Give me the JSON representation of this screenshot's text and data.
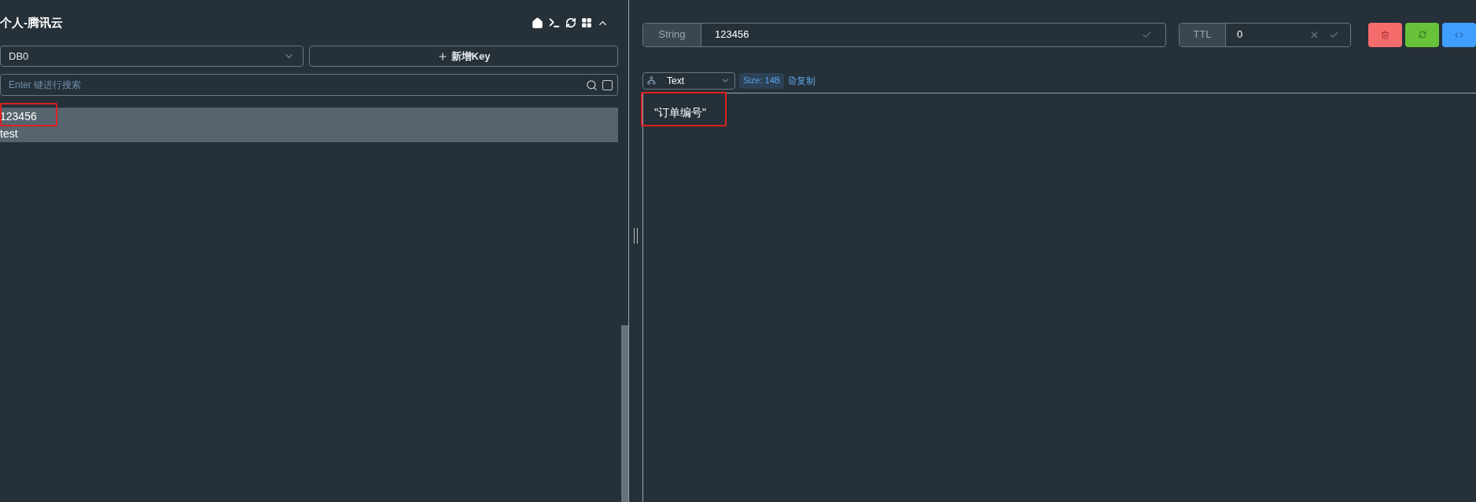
{
  "connection": {
    "title": "个人-腾讯云"
  },
  "db_select": {
    "value": "DB0"
  },
  "new_key_button": {
    "label": "新增Key"
  },
  "search": {
    "placeholder": "Enter 键进行搜索",
    "exact_checked": false
  },
  "keys": [
    {
      "name": "123456",
      "selected": true,
      "highlighted": true
    },
    {
      "name": "test",
      "selected": true,
      "highlighted": false
    }
  ],
  "detail": {
    "type": "String",
    "key": "123456",
    "ttl_label": "TTL",
    "ttl": "0",
    "format": "Text",
    "size": "Size: 14B",
    "copy": "复制",
    "value": "\"订单编号\"",
    "value_highlighted": true
  }
}
